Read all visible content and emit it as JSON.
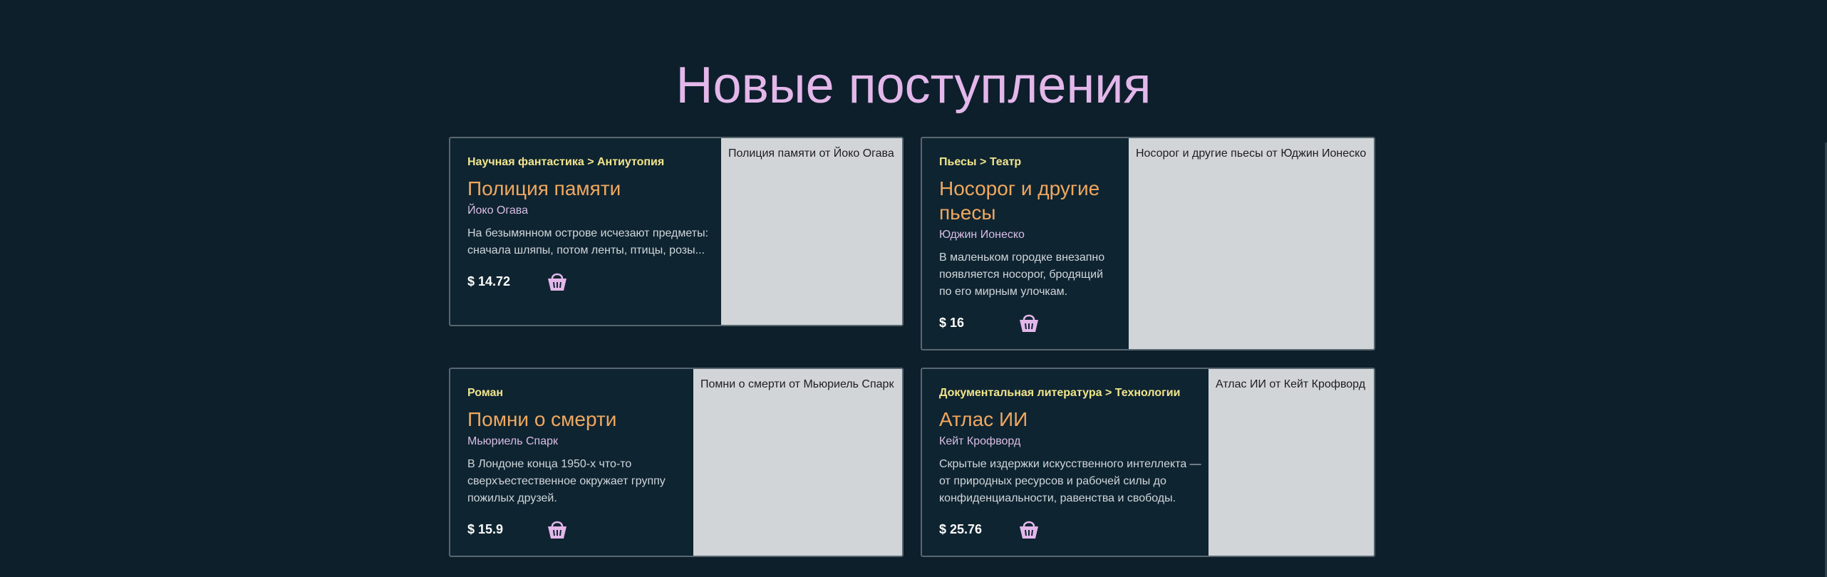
{
  "page": {
    "heading": "Новые поступления"
  },
  "colors": {
    "background": "#0c1f2b",
    "heading": "#e4b7ea",
    "category": "#f1e58c",
    "title": "#f0a85f",
    "author": "#d9bde6",
    "cart_icon": "#e4b7ea"
  },
  "books": [
    {
      "category": "Научная фантастика > Антиутопия",
      "title": "Полиция памяти",
      "author": "Йоко Огава",
      "description": "На безымянном острове исчезают предметы: сначала шляпы, потом ленты, птицы, розы...",
      "price": "$ 14.72",
      "cover_alt": "Полиция памяти от Йоко Огава",
      "cart_icon": "shopping-basket-icon"
    },
    {
      "category": "Пьесы > Театр",
      "title": "Носорог и другие пьесы",
      "author": "Юджин Ионеско",
      "description": "В маленьком городке внезапно появляется носорог, бродящий по его мирным улочкам.",
      "price": "$ 16",
      "cover_alt": "Носорог и другие пьесы от Юджин Ионеско",
      "cart_icon": "shopping-basket-icon"
    },
    {
      "category": "Роман",
      "title": "Помни о смерти",
      "author": "Мьюриель Спарк",
      "description": "В Лондоне конца 1950-х что-то сверхъестественное окружает группу пожилых друзей.",
      "price": "$ 15.9",
      "cover_alt": "Помни о смерти от Мьюриель Спарк",
      "cart_icon": "shopping-basket-icon"
    },
    {
      "category": "Документальная литература > Технологии",
      "title": "Атлас ИИ",
      "author": "Кейт Крофворд",
      "description": "Скрытые издержки искусственного интеллекта — от природных ресурсов и рабочей силы до конфиденциальности, равенства и свободы.",
      "price": "$ 25.76",
      "cart_icon": "shopping-basket-icon",
      "cover_alt": "Атлас ИИ от Кейт Крофворд"
    }
  ]
}
